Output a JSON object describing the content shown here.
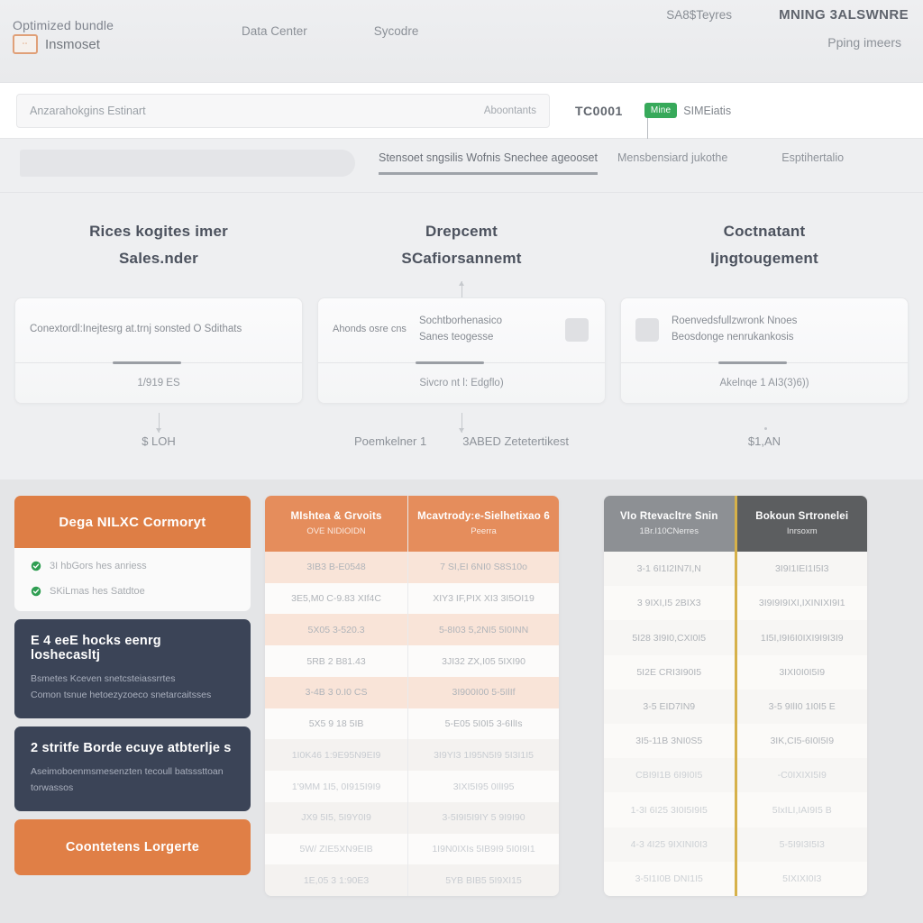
{
  "header": {
    "brand_line1": "Optimized bundle",
    "brand_line2": "Insmoset",
    "logo_icon": "orange-square-logo",
    "nav": [
      {
        "label": "Data Center"
      },
      {
        "label": "Sycodre"
      }
    ],
    "right": {
      "services_label": "SA8$Teyres",
      "title": "MNING 3ALSWNRE",
      "subtitle": "Pping imeers"
    }
  },
  "search": {
    "placeholder": "Anzarahokgins Estinart",
    "action_label": "Aboontants",
    "code": "TC0001",
    "badge": "Mine",
    "badge_text": "SIMEiatis"
  },
  "tabs": [
    {
      "label": "Stensoet sngsilis Wofnis Snechee ageooset",
      "active": true
    },
    {
      "label": "Mensbensiard jukothe",
      "active": false
    },
    {
      "label": "Esptihertalio",
      "active": false
    }
  ],
  "process": [
    {
      "title": "Rices kogites imer\nSales.nder",
      "card_label": "Conextordl:Inejtesrg at.trnj sonsted O Sdithats",
      "card_bottom": "1/919 ES",
      "footer_left": "",
      "footer_main": "$ LOH",
      "icon": "",
      "arrow_up": false,
      "arrow_down": true
    },
    {
      "title": "Drepcemt\nSCafiorsannemt",
      "card_label_left": "Ahonds osre cns",
      "card_label": "Sochtborhenasico\nSanes teogesse",
      "card_bottom": "Sivcro nt l: Edgflo)",
      "footer_left": "Poemkelner 1",
      "footer_main": "3ABED Zetetertikest",
      "icon": "grey-square-icon",
      "arrow_up": true,
      "arrow_down": true
    },
    {
      "title": "Coctnatant\nIjngtougement",
      "card_label": "Roenvedsfullzwronk Nnoes\nBeosdonge nenrukankosis",
      "card_bottom": "Akelnqe 1 AI3(3)6))",
      "footer_left": "",
      "footer_main": "$1,AN",
      "icon": "grey-bag-icon",
      "arrow_up": false,
      "arrow_down": false
    }
  ],
  "plan": {
    "header_title": "Dega NILXC Cormoryt",
    "features": [
      {
        "icon": "green-check-icon",
        "text": "3I hbGors hes anriess"
      },
      {
        "icon": "green-check-icon",
        "text": "SKiLmas hes Satdtoe"
      }
    ],
    "cards": [
      {
        "title": "E 4 eeE hocks eenrg loshecasltj",
        "body": "Bsmetes Kceven snetcsteiassrrtes\nComon tsnue hetoezyzoeco snetarcaitsses"
      },
      {
        "title": "2 stritfe Borde ecuye atbterlje s",
        "body": "Aseimoboenmsmesenzten tecoull batsssttoan torwassos"
      }
    ],
    "cta_label": "Coontetens Lorgerte"
  },
  "tables": [
    {
      "id": "center-table",
      "columns": [
        {
          "header_title": "MIshtea & Grvoits",
          "header_sub": "OVE NIDIOIDN",
          "header_style": "orange",
          "cells": [
            "3IB3 B-E0548",
            "3E5,M0 C-9.83 XIf4C",
            "5X05 3-520.3",
            "5RB 2 B81.43",
            "3-4B 3 0.I0 CS",
            "5X5 9 18 5IB",
            "1I0K46 1:9E95N9EI9",
            "1'9MM 1I5, 0I915I9I9",
            "JX9 5I5, 5I9Y0I9",
            "5W/ ZIE5XN9EIB",
            "1E,05 3 1:90E3"
          ]
        },
        {
          "header_title": "Mcavtrody:e-Sielhetixao 6",
          "header_sub": "Peerra",
          "header_style": "orange",
          "cells": [
            "7 SI,EI 6NI0 S8S10o",
            "XIY3 IF,PIX XI3 3I5OI19",
            "5-8I03 5,2NI5 5I0INN",
            "3JI32 ZX,I05 5IXI90",
            "3I900I00 5-5IlIf",
            "5-E05 5I0I5 3-6IlIs",
            "3I9YI3 1I95N5I9 5I3I1I5",
            "3IXI5I95 0IlI95",
            "3-5I9I5I9IY 5 9I9I90",
            "1I9N0IXIs 5IB9I9 5I0I9I1",
            "5YB BIB5 5I9XI15"
          ]
        }
      ]
    },
    {
      "id": "right-table",
      "columns": [
        {
          "header_title": "VIo Rtevacltre Snin",
          "header_sub": "1Br.I10CNerres",
          "header_style": "grey",
          "cells": [
            "3-1 6I1I2IN7I,N",
            "3 9IXI,I5 2BIX3",
            "5I28 3I9I0,CXI0I5",
            "5I2E CRI3I90I5",
            "3-5 EID7IN9",
            "3I5-11B 3NI0S5",
            "CBI9I1B 6I9I0I5",
            "1-3I 6I25 3I0I5I9I5",
            "4-3 4I25 9IXINI0I3",
            "3-5I1I0B DNI1I5"
          ]
        },
        {
          "header_title": "Bokoun Srtronelei",
          "header_sub": "Inrsoxm",
          "header_style": "dark",
          "gold_edge": true,
          "cells": [
            "3I9I1IEI1I5I3",
            "3I9I9I9IXI,IXINIXI9I1",
            "1I5I,I9I6I0IXI9I9I3I9",
            "3IXI0I0I5I9",
            "3-5 9IlI0 1I0I5 E",
            "3IK,CI5-6I0I5I9",
            "-C0IXIXI5I9",
            "5IxILI,IAI9I5 B",
            "5-5I9I3I5I3",
            "5IXIXI0I3"
          ]
        }
      ]
    }
  ],
  "colors": {
    "accent_orange": "#de7e45",
    "table_header_orange": "#e58d5c",
    "dark_navy": "#3b4457",
    "badge_green": "#37a95a",
    "grey_header": "#8d9094",
    "dark_grey_header": "#5c5e60",
    "gold_divider": "#d6b14a",
    "page_bg": "#e9eaec"
  }
}
